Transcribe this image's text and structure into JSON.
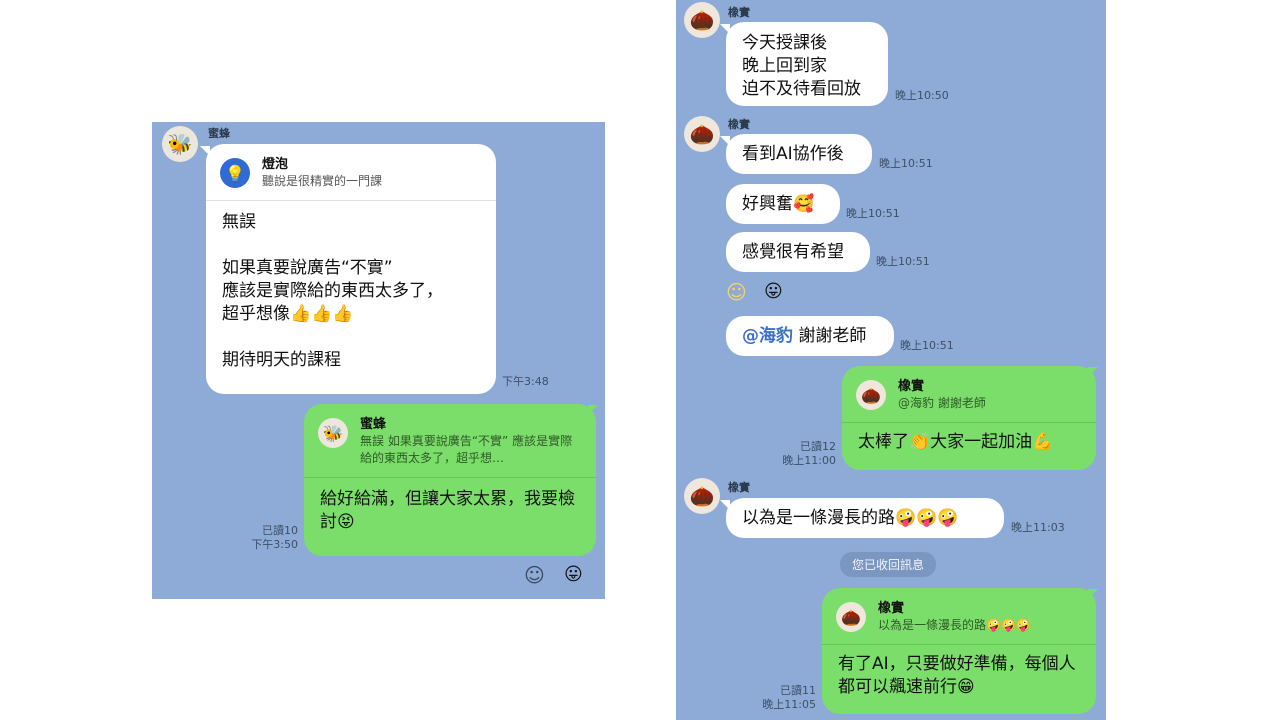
{
  "left_chat": {
    "msg1": {
      "sender": "蜜蜂",
      "reply_title": "燈泡",
      "reply_text": "聽說是很精實的一門課",
      "text": "無誤\n\n如果真要說廣告“不實”\n應該是實際給的東西太多了，\n超乎想像👍👍👍\n\n期待明天的課程",
      "time": "下午3:48"
    },
    "msg2": {
      "reply_title": "蜜蜂",
      "reply_text": "無誤 如果真要說廣告“不實” 應該是實際給的東西太多了，超乎想…",
      "text": "給好給滿，但讓大家太累，我要檢討😝",
      "read": "已讀10",
      "time": "下午3:50"
    }
  },
  "right_chat": {
    "sender": "橡實",
    "msg1": {
      "text": "今天授課後\n晚上回到家\n迫不及待看回放",
      "time": "晚上10:50"
    },
    "msg2": {
      "text": "看到AI協作後",
      "time": "晚上10:51"
    },
    "msg3": {
      "text": "好興奮🥰",
      "time": "晚上10:51"
    },
    "msg4": {
      "text": "感覺很有希望",
      "time": "晚上10:51"
    },
    "msg5": {
      "mention": "@海豹",
      "text": "謝謝老師",
      "time": "晚上10:51"
    },
    "msg6": {
      "reply_title": "橡實",
      "reply_text": "@海豹 謝謝老師",
      "text": "太棒了👏大家一起加油💪",
      "read": "已讀12",
      "time": "晚上11:00"
    },
    "msg7": {
      "text": "以為是一條漫長的路🤪🤪🤪",
      "time": "晚上11:03"
    },
    "system": "您已收回訊息",
    "msg8": {
      "reply_title": "橡實",
      "reply_text": "以為是一條漫長的路🤪🤪🤪",
      "text": "有了AI，只要做好準備，每個人都可以飆速前行😁",
      "read": "已讀11",
      "time": "晚上11:05"
    }
  },
  "icons": {
    "bee_avatar": "🐝",
    "acorn_avatar": "🌰",
    "bulb_icon": "💡",
    "emoji_button": "☺",
    "sticker_button": "😛"
  },
  "colors": {
    "chat_bg": "#8eabd8",
    "green_bubble": "#7cde6a",
    "white_bubble": "#ffffff"
  }
}
